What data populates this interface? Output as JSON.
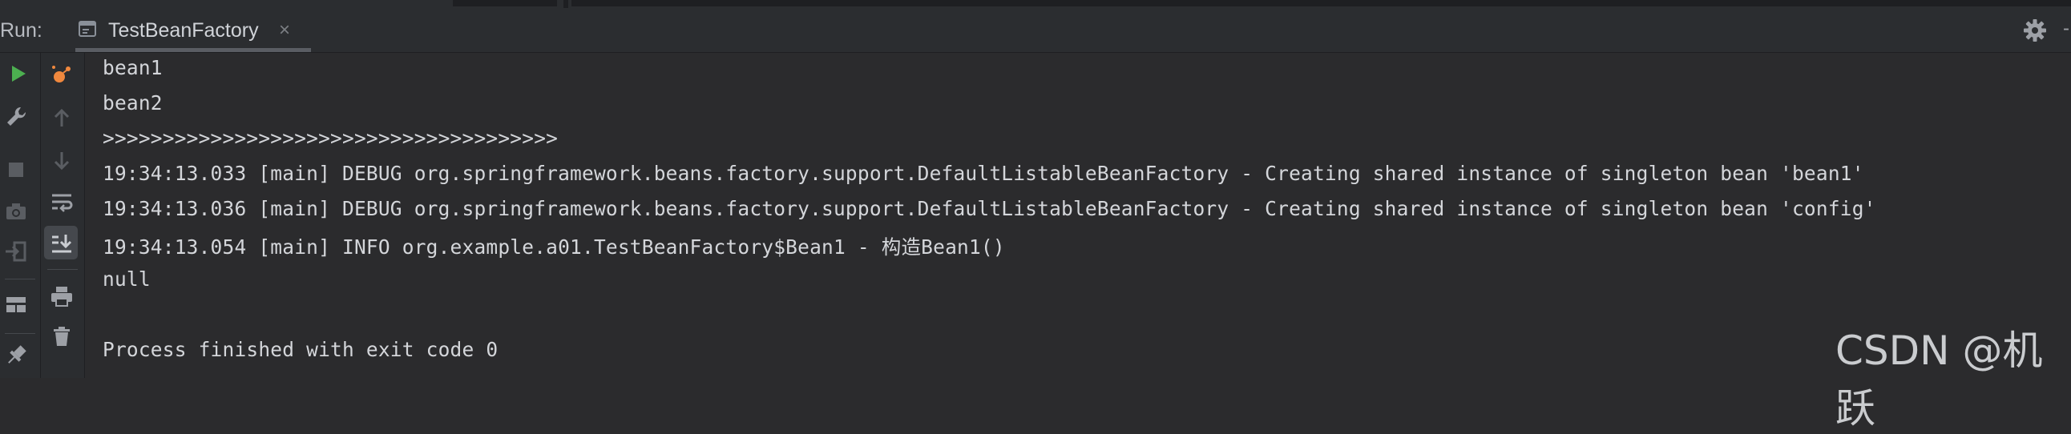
{
  "run_panel": {
    "run_label": "Run:",
    "tab": {
      "label": "TestBeanFactory",
      "close_glyph": "×"
    },
    "settings_icon": "gear-icon",
    "hide_glyph": "-"
  },
  "left_toolbar": [
    {
      "name": "rerun-icon",
      "color": "#4caf50"
    },
    {
      "name": "wrench-icon"
    },
    {
      "name": "stop-icon"
    },
    {
      "name": "camera-icon"
    },
    {
      "name": "exit-icon"
    },
    {
      "name": "layout-icon"
    },
    {
      "name": "pin-icon"
    }
  ],
  "side_toolbar": [
    {
      "name": "debug-services-icon",
      "color": "#f0883e"
    },
    {
      "name": "arrow-up-icon"
    },
    {
      "name": "arrow-down-icon"
    },
    {
      "name": "soft-wrap-icon"
    },
    {
      "name": "scroll-to-end-icon"
    },
    {
      "name": "print-icon"
    },
    {
      "name": "trash-icon"
    }
  ],
  "console": {
    "lines": [
      "bean1",
      "bean2",
      ">>>>>>>>>>>>>>>>>>>>>>>>>>>>>>>>>>>>>>",
      "19:34:13.033 [main] DEBUG org.springframework.beans.factory.support.DefaultListableBeanFactory - Creating shared instance of singleton bean 'bean1'",
      "19:34:13.036 [main] DEBUG org.springframework.beans.factory.support.DefaultListableBeanFactory - Creating shared instance of singleton bean 'config'",
      "19:34:13.054 [main] INFO org.example.a01.TestBeanFactory$Bean1 - 构造Bean1()",
      "null",
      "",
      "Process finished with exit code 0"
    ]
  },
  "watermark": "CSDN @机跃",
  "colors": {
    "background": "#2b2b2d",
    "panel": "#2b2d30",
    "text": "#d4d6da",
    "run_green": "#4caf50",
    "debug_orange": "#f0883e"
  }
}
